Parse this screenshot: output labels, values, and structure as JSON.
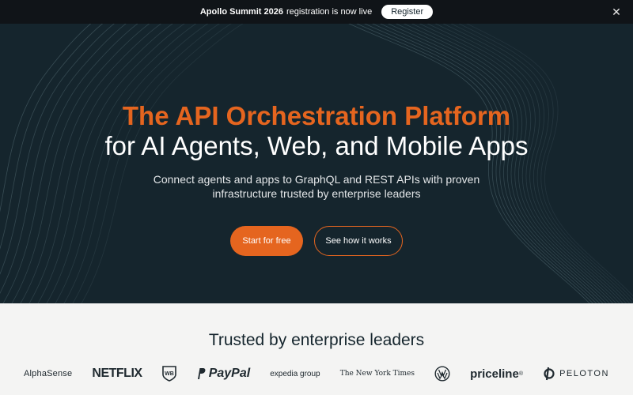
{
  "announcement": {
    "event": "Apollo Summit 2026",
    "message": "registration is now live",
    "register_label": "Register",
    "close_icon": "close-icon"
  },
  "hero": {
    "title_line1": "The API Orchestration Platform",
    "title_line2": "for AI Agents, Web, and Mobile Apps",
    "subtitle": "Connect agents and apps to GraphQL and REST APIs with proven infrastructure trusted by enterprise leaders",
    "primary_cta": "Start for free",
    "secondary_cta": "See how it works"
  },
  "trusted": {
    "title": "Trusted by enterprise leaders",
    "logos": {
      "alphasense": "AlphaSense",
      "netflix": "NETFLIX",
      "warner": "WB",
      "paypal": "PayPal",
      "expedia": "expedia group",
      "nyt": "The New York Times",
      "vw": "VW",
      "priceline": "priceline",
      "priceline_mark": "®",
      "peloton": "PELOTON"
    }
  },
  "colors": {
    "accent": "#e5651f",
    "hero_bg": "#15252d",
    "banner_bg": "#101418",
    "light_bg": "#f4f4f3"
  }
}
